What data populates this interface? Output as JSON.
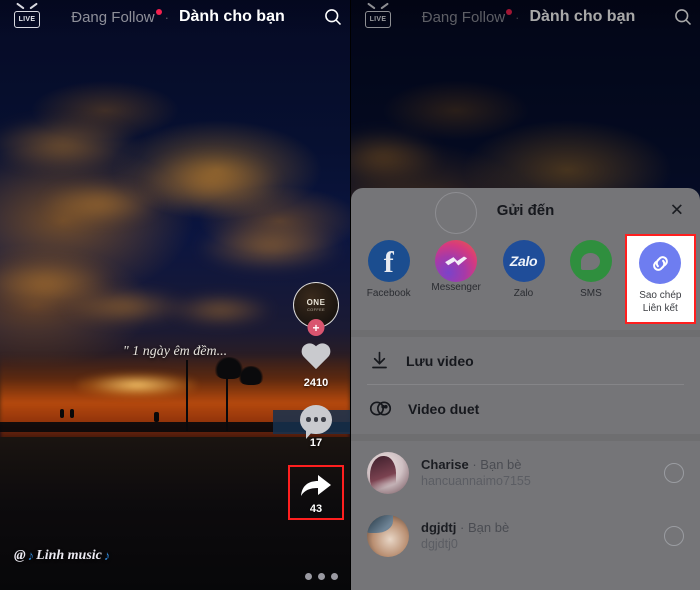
{
  "nav": {
    "live_label": "LIVE",
    "tab_following": "Đang Follow",
    "tab_separator": "·",
    "tab_foryou": "Dành cho bạn",
    "search_icon": "search-icon"
  },
  "video": {
    "caption": "\" 1 ngày êm đềm...",
    "username": "Linh music",
    "username_prefix": "@",
    "note_glyph": "♪",
    "avatar_brand_line1": "ONE",
    "avatar_brand_line2": "COFFEE",
    "follow_plus": "+",
    "like_count": "2410",
    "comment_count": "17",
    "share_count": "43"
  },
  "sheet": {
    "title": "Gửi đến",
    "close_label": "✕",
    "apps": [
      {
        "name": "Facebook",
        "icon": "facebook-icon",
        "glyph": "f",
        "highlight": false
      },
      {
        "name": "Messenger",
        "icon": "messenger-icon",
        "glyph": "",
        "highlight": false
      },
      {
        "name": "Zalo",
        "icon": "zalo-icon",
        "glyph": "Zalo",
        "highlight": false
      },
      {
        "name": "SMS",
        "icon": "sms-icon",
        "glyph": "",
        "highlight": false
      },
      {
        "name": "Sao chép\nLiên kết",
        "icon": "copy-link-icon",
        "glyph": "",
        "highlight": true
      }
    ],
    "actions": [
      {
        "label": "Lưu video",
        "icon": "download-icon"
      },
      {
        "label": "Video duet",
        "icon": "duet-icon"
      }
    ],
    "contacts": [
      {
        "name": "Charise",
        "relation": "Bạn bè",
        "handle": "hancuannaimo7155",
        "separator": "·"
      },
      {
        "name": "dgjdtj",
        "relation": "Bạn bè",
        "handle": "dgjdtj0",
        "separator": "·"
      }
    ]
  },
  "colors": {
    "highlight_red": "#ff1f1f",
    "sheet_bg": "#757578",
    "facebook": "#1b4d8f",
    "zalo": "#1f4d99",
    "sms": "#2f8f3e",
    "copy_link": "#6e7df0",
    "live_dot": "#f4204e"
  }
}
